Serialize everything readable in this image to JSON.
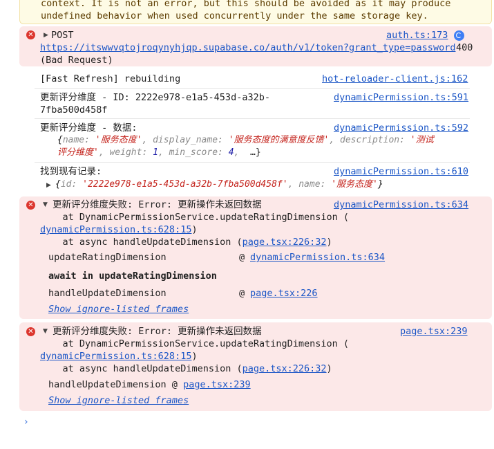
{
  "warning": {
    "line1": "context. It is not an error, but this should be avoided as it may produce",
    "line2": "undefined behavior when used concurrently under the same storage key."
  },
  "post_error": {
    "method": "POST",
    "source": "auth.ts:173",
    "url": "https://itswwvqtojroqynyhjqp.supabase.co/auth/v1/token?grant_type=password",
    "status": "400",
    "status_text": "(Bad Request)"
  },
  "fast_refresh": {
    "text": "[Fast Refresh] rebuilding",
    "source": "hot-reloader-client.js:162"
  },
  "update_log": {
    "line1": "更新评分维度 - ID: 2222e978-e1a5-453d-a32b-",
    "line2": "7fba500d458f",
    "source": "dynamicPermission.ts:591"
  },
  "data_log": {
    "title": "更新评分维度 - 数据:",
    "source": "dynamicPermission.ts:592",
    "obj_open": "{",
    "k_name": "name",
    "v_name": "'服务态度'",
    "k_display": "display_name",
    "v_display": "'服务态度的满意度反馈'",
    "k_desc": "description",
    "v_desc_1": "'测试",
    "v_desc_2": "评分维度'",
    "k_weight": "weight",
    "v_weight": "1",
    "k_min": "min_score",
    "v_min": "4",
    "ellipsis": "…}"
  },
  "found_log": {
    "title": "找到现有记录:",
    "source": "dynamicPermission.ts:610",
    "k_id": "id",
    "v_id": "'2222e978-e1a5-453d-a32b-7fba500d458f'",
    "k_name": "name",
    "v_name": "'服务态度'"
  },
  "error1": {
    "message": "更新评分维度失败: Error: 更新操作未返回数据",
    "source": "dynamicPermission.ts:634",
    "stack1": "    at DynamicPermissionService.updateRatingDimension (",
    "stack1_link": "dynamicPermission.ts:628:15",
    "stack2_prefix": "    at async handleUpdateDimension (",
    "stack2_link": "page.tsx:226:32",
    "frame1_name": "updateRatingDimension",
    "frame1_at": "@",
    "frame1_link": "dynamicPermission.ts:634",
    "await_label": "await in updateRatingDimension",
    "frame2_name": "handleUpdateDimension",
    "frame2_at": "@",
    "frame2_link": "page.tsx:226",
    "show_frames": "Show ignore-listed frames"
  },
  "error2": {
    "message": "更新评分维度失败: Error: 更新操作未返回数据",
    "source": "page.tsx:239",
    "stack1": "    at DynamicPermissionService.updateRatingDimension (",
    "stack1_link": "dynamicPermission.ts:628:15",
    "stack2_prefix": "    at async handleUpdateDimension (",
    "stack2_link": "page.tsx:226:32",
    "frame1_text": "handleUpdateDimension @ ",
    "frame1_link": "page.tsx:239",
    "show_frames": "Show ignore-listed frames"
  },
  "icons": {
    "error": "error-circle-icon",
    "expand": "triangle-icon",
    "refresh": "refresh-icon",
    "prompt": "chevron-right-icon"
  },
  "colors": {
    "error_bg": "#fce8e8",
    "warning_bg": "#fefbe5",
    "link": "#1a55c6",
    "string": "#c4231c"
  }
}
